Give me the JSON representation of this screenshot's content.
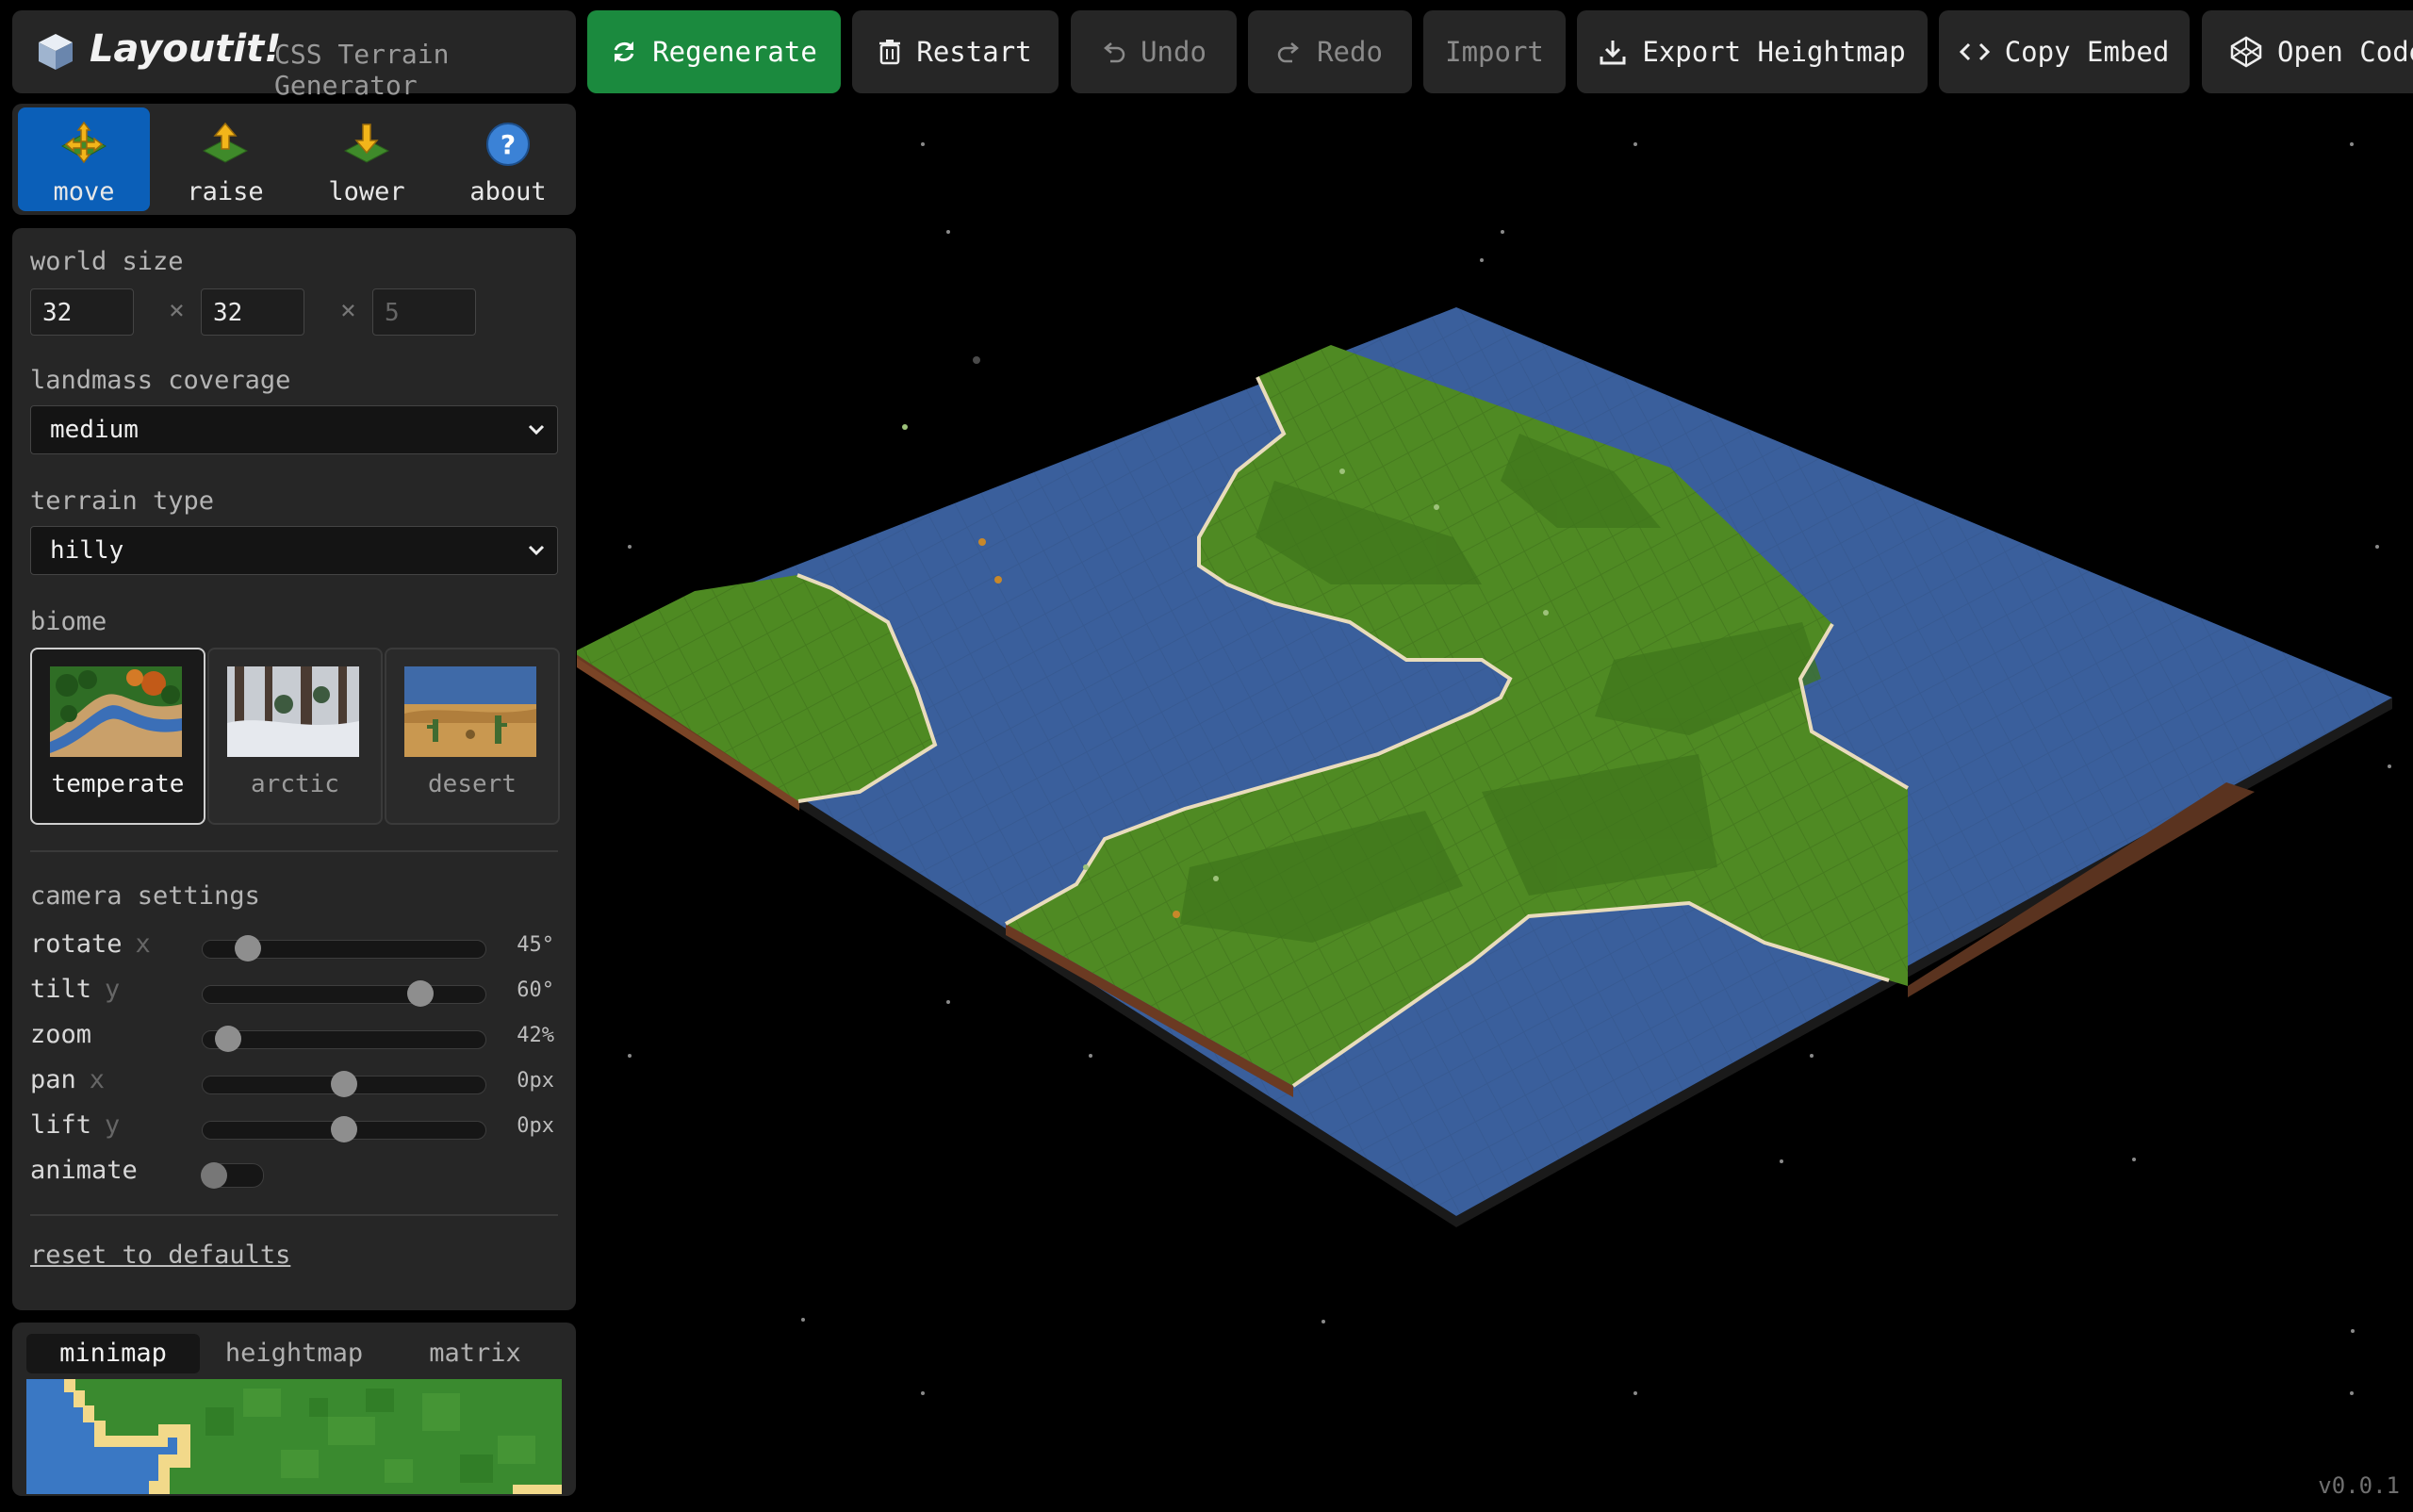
{
  "app": {
    "name": "Layoutit!",
    "subtitle": "CSS Terrain Generator",
    "version": "v0.0.1"
  },
  "toolbar": {
    "regenerate": "Regenerate",
    "restart": "Restart",
    "undo": "Undo",
    "redo": "Redo",
    "import": "Import",
    "export": "Export Heightmap",
    "embed": "Copy Embed",
    "open_code": "Open Code"
  },
  "tools": [
    {
      "label": "move",
      "icon": "move-icon",
      "active": true
    },
    {
      "label": "raise",
      "icon": "raise-icon",
      "active": false
    },
    {
      "label": "lower",
      "icon": "lower-icon",
      "active": false
    },
    {
      "label": "about",
      "icon": "help-icon",
      "active": false
    }
  ],
  "settings": {
    "world_size": {
      "label": "world size",
      "x": "32",
      "y": "32",
      "z": "5",
      "separator": "×"
    },
    "landmass": {
      "label": "landmass coverage",
      "value": "medium"
    },
    "terrain": {
      "label": "terrain type",
      "value": "hilly"
    },
    "biome": {
      "label": "biome",
      "options": [
        {
          "label": "temperate",
          "active": true
        },
        {
          "label": "arctic",
          "active": false
        },
        {
          "label": "desert",
          "active": false
        }
      ]
    },
    "camera": {
      "label": "camera settings",
      "sliders": [
        {
          "name": "rotate",
          "axis": "x",
          "value": "45°",
          "level": 0.16
        },
        {
          "name": "tilt",
          "axis": "y",
          "value": "60°",
          "level": 0.77
        },
        {
          "name": "zoom",
          "axis": "",
          "value": "42%",
          "level": 0.09
        },
        {
          "name": "pan",
          "axis": "x",
          "value": "0px",
          "level": 0.5
        },
        {
          "name": "lift",
          "axis": "y",
          "value": "0px",
          "level": 0.5
        }
      ],
      "animate": {
        "label": "animate",
        "on": false
      }
    },
    "reset": "reset to defaults"
  },
  "map_tabs": [
    {
      "label": "minimap",
      "active": true
    },
    {
      "label": "heightmap",
      "active": false
    },
    {
      "label": "matrix",
      "active": false
    }
  ],
  "colors": {
    "accent": "#0b5fb8",
    "regenerate": "#1b8a3e",
    "water": "#3a5f9c",
    "grass": "#4f8a23",
    "panel": "#262626"
  }
}
